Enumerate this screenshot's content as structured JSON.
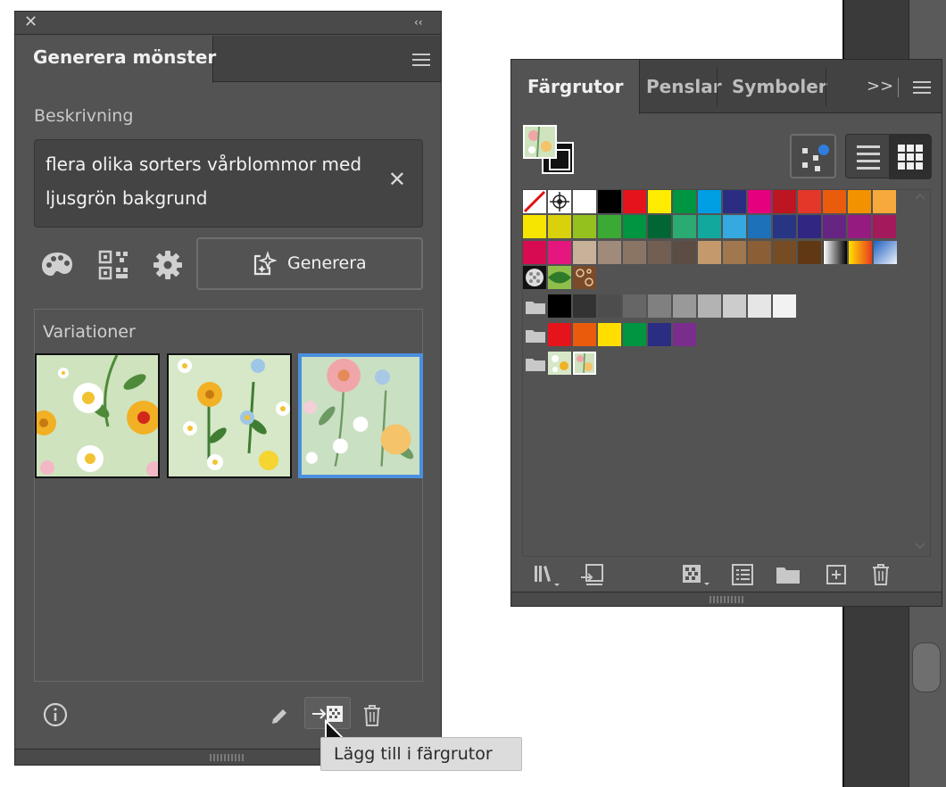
{
  "left_panel": {
    "tab_title": "Generera mönster",
    "description_label": "Beskrivning",
    "description_value": "flera olika sorters vårblommor med ljusgrön bakgrund",
    "generate_label": "Generera",
    "variations_label": "Variationer",
    "tooltip": "Lägg till i färgrutor"
  },
  "right_panel": {
    "tabs": [
      "Färgrutor",
      "Penslar",
      "Symboler"
    ],
    "overflow": ">>"
  },
  "colors": {
    "panel_bg": "#535353",
    "selected_border": "#4a8fe0",
    "pattern_bg": "#cfe3bf"
  },
  "swatches": {
    "row1": [
      "#ffffff",
      "#000000",
      "#e4131c",
      "#ffec00",
      "#009540",
      "#009ee2",
      "#2b2d83",
      "#e5007e",
      "#be1522",
      "#e5362a",
      "#ea5b0c",
      "#f39200",
      "#f7a93b"
    ],
    "row2": [
      "#f6e500",
      "#d9d10c",
      "#95c11f",
      "#3aaa35",
      "#009540",
      "#006633",
      "#2aab71",
      "#13a89e",
      "#36a9e1",
      "#1d71b8",
      "#283583",
      "#312783",
      "#662483",
      "#951b81",
      "#a3195b"
    ],
    "row3": [
      "#d60b52",
      "#e5177e",
      "#c7b299",
      "#a08a7a",
      "#8a7565",
      "#725f52",
      "#5c4d44",
      "#c49a6c",
      "#a0774e",
      "#8b5e35",
      "#754c24",
      "#603813",
      "#42210b"
    ],
    "grays": [
      "#000000",
      "#333333",
      "#4d4d4d",
      "#666666",
      "#808080",
      "#999999",
      "#b3b3b3",
      "#cccccc",
      "#e6e6e6",
      "#f2f2f2"
    ],
    "group2": [
      "#e4131c",
      "#ea5b0c",
      "#ffde00",
      "#009540",
      "#2b2d83",
      "#7b2d8e"
    ]
  }
}
